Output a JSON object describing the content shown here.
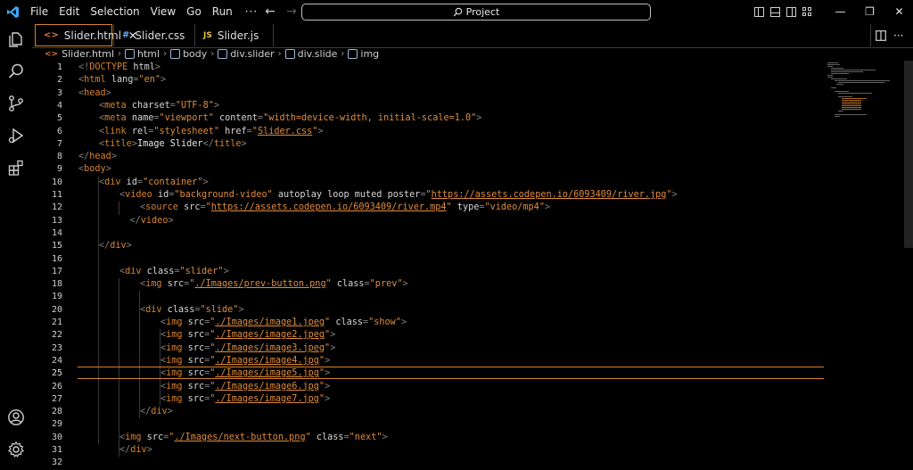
{
  "menu": [
    "File",
    "Edit",
    "Selection",
    "View",
    "Go",
    "Run"
  ],
  "menu_more": "···",
  "search": {
    "label": "Project"
  },
  "window_controls": {
    "minimize": "—",
    "restore": "❐",
    "close": "✕"
  },
  "tabs": [
    {
      "label": "Slider.html",
      "type_icon": "<>",
      "icon_color": "#e0773b",
      "active": true,
      "close": "✕"
    },
    {
      "label": "Slider.css",
      "type_icon": "#",
      "icon_color": "#6cb2ff",
      "active": false
    },
    {
      "label": "Slider.js",
      "type_icon": "JS",
      "icon_color": "#e5c347",
      "active": false
    }
  ],
  "tab_actions": {
    "split": "split-editor-icon",
    "more": "···"
  },
  "breadcrumb": [
    "Slider.html",
    "html",
    "body",
    "div.slider",
    "div.slide",
    "img"
  ],
  "current_line": 25,
  "colors": {
    "accent": "#d9822b",
    "tag": "#d9822b",
    "string": "#e08c3c",
    "attr": "#d7d7d7",
    "punctuation": "#808080",
    "text": "#e8e8e8"
  },
  "code": [
    {
      "n": 1,
      "indent": 0,
      "tokens": [
        [
          "p",
          "<!"
        ],
        [
          "t",
          "DOCTYPE"
        ],
        [
          "a",
          " html"
        ],
        [
          "p",
          ">"
        ]
      ]
    },
    {
      "n": 2,
      "indent": 0,
      "tokens": [
        [
          "p",
          "<"
        ],
        [
          "t",
          "html"
        ],
        [
          "a",
          " lang"
        ],
        [
          "p",
          "="
        ],
        [
          "s",
          "\"en\""
        ],
        [
          "p",
          ">"
        ]
      ]
    },
    {
      "n": 3,
      "indent": 0,
      "tokens": [
        [
          "p",
          "<"
        ],
        [
          "t",
          "head"
        ],
        [
          "p",
          ">"
        ]
      ]
    },
    {
      "n": 4,
      "indent": 1,
      "tokens": [
        [
          "p",
          "<"
        ],
        [
          "t",
          "meta"
        ],
        [
          "a",
          " charset"
        ],
        [
          "p",
          "="
        ],
        [
          "s",
          "\"UTF-8\""
        ],
        [
          "p",
          ">"
        ]
      ]
    },
    {
      "n": 5,
      "indent": 1,
      "tokens": [
        [
          "p",
          "<"
        ],
        [
          "t",
          "meta"
        ],
        [
          "a",
          " name"
        ],
        [
          "p",
          "="
        ],
        [
          "s",
          "\"viewport\""
        ],
        [
          "a",
          " content"
        ],
        [
          "p",
          "="
        ],
        [
          "s",
          "\"width=device-width, initial-scale=1.0\""
        ],
        [
          "p",
          ">"
        ]
      ]
    },
    {
      "n": 6,
      "indent": 1,
      "tokens": [
        [
          "p",
          "<"
        ],
        [
          "t",
          "link"
        ],
        [
          "a",
          " rel"
        ],
        [
          "p",
          "="
        ],
        [
          "s",
          "\"stylesheet\""
        ],
        [
          "a",
          " href"
        ],
        [
          "p",
          "="
        ],
        [
          "s",
          "\""
        ],
        [
          "sl",
          "Slider.css"
        ],
        [
          "s",
          "\""
        ],
        [
          "p",
          ">"
        ]
      ]
    },
    {
      "n": 7,
      "indent": 1,
      "tokens": [
        [
          "p",
          "<"
        ],
        [
          "t",
          "title"
        ],
        [
          "p",
          ">"
        ],
        [
          "x",
          "Image Slider"
        ],
        [
          "p",
          "</"
        ],
        [
          "t",
          "title"
        ],
        [
          "p",
          ">"
        ]
      ]
    },
    {
      "n": 8,
      "indent": 0,
      "tokens": [
        [
          "p",
          "</"
        ],
        [
          "t",
          "head"
        ],
        [
          "p",
          ">"
        ]
      ]
    },
    {
      "n": 9,
      "indent": 0,
      "tokens": [
        [
          "p",
          "<"
        ],
        [
          "t",
          "body"
        ],
        [
          "p",
          ">"
        ]
      ]
    },
    {
      "n": 10,
      "indent": 1,
      "tokens": [
        [
          "p",
          "<"
        ],
        [
          "t",
          "div"
        ],
        [
          "a",
          " id"
        ],
        [
          "p",
          "="
        ],
        [
          "s",
          "\"container\""
        ],
        [
          "p",
          ">"
        ]
      ]
    },
    {
      "n": 11,
      "indent": 2,
      "tokens": [
        [
          "p",
          "<"
        ],
        [
          "t",
          "video"
        ],
        [
          "a",
          " id"
        ],
        [
          "p",
          "="
        ],
        [
          "s",
          "\"background-video\""
        ],
        [
          "a",
          " autoplay loop muted poster"
        ],
        [
          "p",
          "="
        ],
        [
          "s",
          "\""
        ],
        [
          "sl",
          "https://assets.codepen.io/6093409/river.jpg"
        ],
        [
          "s",
          "\""
        ],
        [
          "p",
          ">"
        ]
      ]
    },
    {
      "n": 12,
      "indent": 3,
      "tokens": [
        [
          "p",
          "<"
        ],
        [
          "t",
          "source"
        ],
        [
          "a",
          " src"
        ],
        [
          "p",
          "="
        ],
        [
          "s",
          "\""
        ],
        [
          "sl",
          "https://assets.codepen.io/6093409/river.mp4"
        ],
        [
          "s",
          "\""
        ],
        [
          "a",
          " type"
        ],
        [
          "p",
          "="
        ],
        [
          "s",
          "\"video/mp4\""
        ],
        [
          "p",
          ">"
        ]
      ]
    },
    {
      "n": 13,
      "indent": 2,
      "indent_extra": 0.5,
      "tokens": [
        [
          "p",
          "</"
        ],
        [
          "t",
          "video"
        ],
        [
          "p",
          ">"
        ]
      ]
    },
    {
      "n": 14,
      "indent": 0,
      "tokens": []
    },
    {
      "n": 15,
      "indent": 1,
      "tokens": [
        [
          "p",
          "</"
        ],
        [
          "t",
          "div"
        ],
        [
          "p",
          ">"
        ]
      ]
    },
    {
      "n": 16,
      "indent": 0,
      "tokens": []
    },
    {
      "n": 17,
      "indent": 2,
      "tokens": [
        [
          "p",
          "<"
        ],
        [
          "t",
          "div"
        ],
        [
          "a",
          " class"
        ],
        [
          "p",
          "="
        ],
        [
          "s",
          "\"slider\""
        ],
        [
          "p",
          ">"
        ]
      ]
    },
    {
      "n": 18,
      "indent": 3,
      "tokens": [
        [
          "p",
          "<"
        ],
        [
          "t",
          "img"
        ],
        [
          "a",
          " src"
        ],
        [
          "p",
          "="
        ],
        [
          "s",
          "\""
        ],
        [
          "sl",
          "./Images/prev-button.png"
        ],
        [
          "s",
          "\""
        ],
        [
          "a",
          " class"
        ],
        [
          "p",
          "="
        ],
        [
          "s",
          "\"prev\""
        ],
        [
          "p",
          ">"
        ]
      ]
    },
    {
      "n": 19,
      "indent": 0,
      "tokens": []
    },
    {
      "n": 20,
      "indent": 3,
      "tokens": [
        [
          "p",
          "<"
        ],
        [
          "t",
          "div"
        ],
        [
          "a",
          " class"
        ],
        [
          "p",
          "="
        ],
        [
          "s",
          "\"slide\""
        ],
        [
          "p",
          ">"
        ]
      ]
    },
    {
      "n": 21,
      "indent": 4,
      "tokens": [
        [
          "p",
          "<"
        ],
        [
          "t",
          "img"
        ],
        [
          "a",
          " src"
        ],
        [
          "p",
          "="
        ],
        [
          "s",
          "\""
        ],
        [
          "sl",
          "./Images/image1.jpeg"
        ],
        [
          "s",
          "\""
        ],
        [
          "a",
          " class"
        ],
        [
          "p",
          "="
        ],
        [
          "s",
          "\"show\""
        ],
        [
          "p",
          ">"
        ]
      ]
    },
    {
      "n": 22,
      "indent": 4,
      "tokens": [
        [
          "p",
          "<"
        ],
        [
          "t",
          "img"
        ],
        [
          "a",
          " src"
        ],
        [
          "p",
          "="
        ],
        [
          "s",
          "\""
        ],
        [
          "sl",
          "./Images/image2.jpeg"
        ],
        [
          "s",
          "\""
        ],
        [
          "p",
          ">"
        ]
      ]
    },
    {
      "n": 23,
      "indent": 4,
      "tokens": [
        [
          "p",
          "<"
        ],
        [
          "t",
          "img"
        ],
        [
          "a",
          " src"
        ],
        [
          "p",
          "="
        ],
        [
          "s",
          "\""
        ],
        [
          "sl",
          "./Images/image3.jpeg"
        ],
        [
          "s",
          "\""
        ],
        [
          "p",
          ">"
        ]
      ]
    },
    {
      "n": 24,
      "indent": 4,
      "tokens": [
        [
          "p",
          "<"
        ],
        [
          "t",
          "img"
        ],
        [
          "a",
          " src"
        ],
        [
          "p",
          "="
        ],
        [
          "s",
          "\""
        ],
        [
          "sl",
          "./Images/image4.jpg"
        ],
        [
          "s",
          "\""
        ],
        [
          "p",
          ">"
        ]
      ]
    },
    {
      "n": 25,
      "indent": 4,
      "tokens": [
        [
          "p",
          "<"
        ],
        [
          "t",
          "img"
        ],
        [
          "a",
          " src"
        ],
        [
          "p",
          "="
        ],
        [
          "s",
          "\""
        ],
        [
          "sl",
          "./Images/image5.jpg"
        ],
        [
          "s",
          "\""
        ],
        [
          "p",
          ">"
        ]
      ]
    },
    {
      "n": 26,
      "indent": 4,
      "tokens": [
        [
          "p",
          "<"
        ],
        [
          "t",
          "img"
        ],
        [
          "a",
          " src"
        ],
        [
          "p",
          "="
        ],
        [
          "s",
          "\""
        ],
        [
          "sl",
          "./Images/image6.jpg"
        ],
        [
          "s",
          "\""
        ],
        [
          "p",
          ">"
        ]
      ]
    },
    {
      "n": 27,
      "indent": 4,
      "tokens": [
        [
          "p",
          "<"
        ],
        [
          "t",
          "img"
        ],
        [
          "a",
          " src"
        ],
        [
          "p",
          "="
        ],
        [
          "s",
          "\""
        ],
        [
          "sl",
          "./Images/image7.jpg"
        ],
        [
          "s",
          "\""
        ],
        [
          "p",
          ">"
        ]
      ]
    },
    {
      "n": 28,
      "indent": 3,
      "tokens": [
        [
          "p",
          "</"
        ],
        [
          "t",
          "div"
        ],
        [
          "p",
          ">"
        ]
      ]
    },
    {
      "n": 29,
      "indent": 0,
      "tokens": []
    },
    {
      "n": 30,
      "indent": 2,
      "tokens": [
        [
          "p",
          "<"
        ],
        [
          "t",
          "img"
        ],
        [
          "a",
          " src"
        ],
        [
          "p",
          "="
        ],
        [
          "s",
          "\""
        ],
        [
          "sl",
          "./Images/next-button.png"
        ],
        [
          "s",
          "\""
        ],
        [
          "a",
          " class"
        ],
        [
          "p",
          "="
        ],
        [
          "s",
          "\"next\""
        ],
        [
          "p",
          ">"
        ]
      ]
    },
    {
      "n": 31,
      "indent": 2,
      "tokens": [
        [
          "p",
          "</"
        ],
        [
          "t",
          "div"
        ],
        [
          "p",
          ">"
        ]
      ]
    },
    {
      "n": 32,
      "indent": 0,
      "tokens": []
    }
  ]
}
